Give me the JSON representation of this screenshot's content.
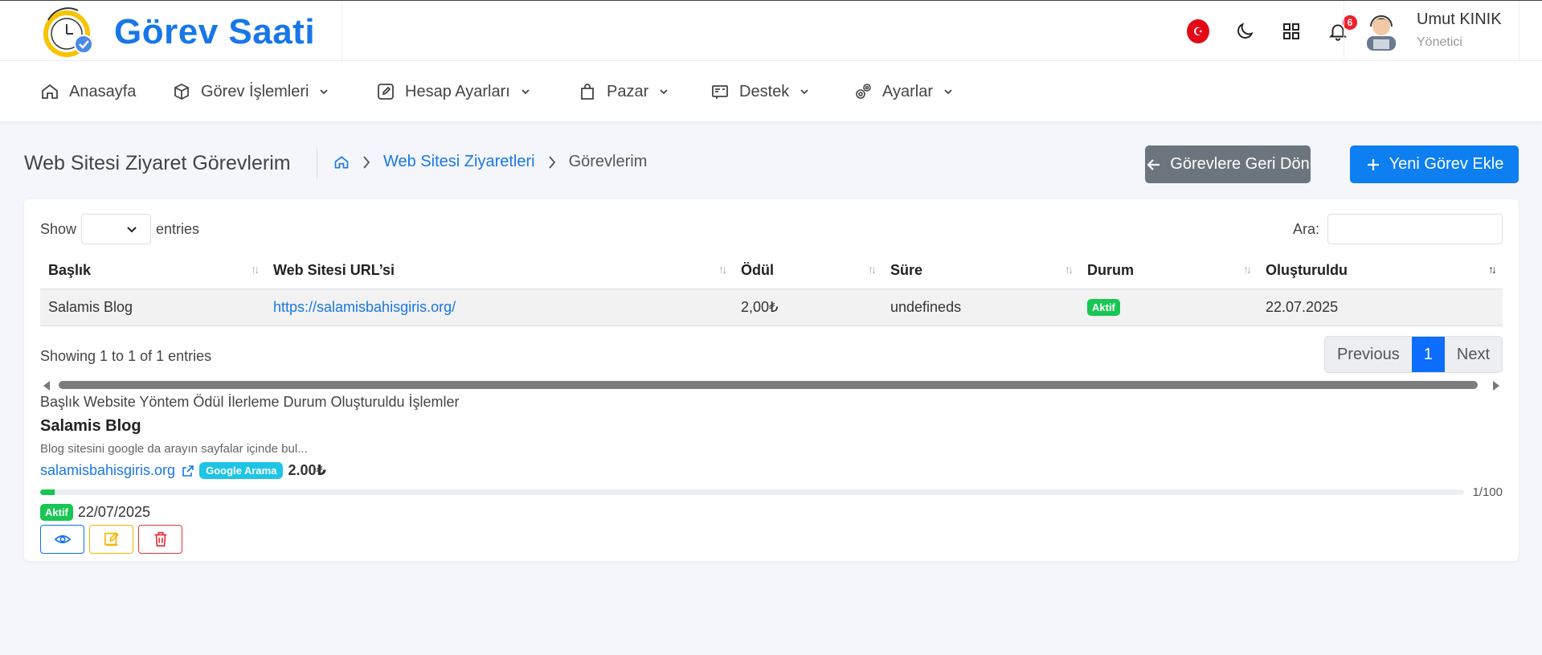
{
  "brand": {
    "title": "Görev Saati"
  },
  "header": {
    "notifications_count": "6",
    "user": {
      "name": "Umut KINIK",
      "role": "Yönetici"
    }
  },
  "nav": {
    "items": [
      {
        "label": "Anasayfa",
        "icon": "home-icon"
      },
      {
        "label": "Görev İşlemleri",
        "icon": "box-icon"
      },
      {
        "label": "Hesap Ayarları",
        "icon": "edit-square-icon"
      },
      {
        "label": "Pazar",
        "icon": "shopping-bag-icon"
      },
      {
        "label": "Destek",
        "icon": "ticket-icon"
      },
      {
        "label": "Ayarlar",
        "icon": "gears-icon"
      }
    ]
  },
  "page": {
    "title": "Web Sitesi Ziyaret Görevlerim",
    "breadcrumb": {
      "link": "Web Sitesi Ziyaretleri",
      "current": "Görevlerim"
    },
    "back_button": "Görevlere Geri Dön",
    "add_button": "Yeni Görev Ekle"
  },
  "table": {
    "show_label": "Show",
    "entries_label": "entries",
    "search_label": "Ara:",
    "columns": [
      "Başlık",
      "Web Sitesi URL’si",
      "Ödül",
      "Süre",
      "Durum",
      "Oluşturuldu"
    ],
    "rows": [
      {
        "title": "Salamis Blog",
        "url": "https://salamisbahisgiris.org/",
        "reward": "2,00₺",
        "duration": "undefineds",
        "status": "Aktif",
        "created": "22.07.2025"
      }
    ],
    "info": "Showing 1 to 1 of 1 entries",
    "pager": {
      "previous": "Previous",
      "page": "1",
      "next": "Next"
    }
  },
  "mobile": {
    "header": "Başlık Website Yöntem Ödül İlerleme Durum Oluşturuldu İşlemler",
    "title": "Salamis Blog",
    "description": "Blog sitesini google da arayın sayfalar içinde bul...",
    "domain": "salamisbahisgiris.org",
    "method": "Google Arama",
    "reward": "2.00₺",
    "progress_fraction": 0.01,
    "progress_text": "1/100",
    "status": "Aktif",
    "date": "22/07/2025"
  },
  "colors": {
    "brand": "#1877e8",
    "success": "#17c653",
    "info": "#1ec4e6",
    "danger": "#e5323e",
    "warning": "#f6b400"
  }
}
